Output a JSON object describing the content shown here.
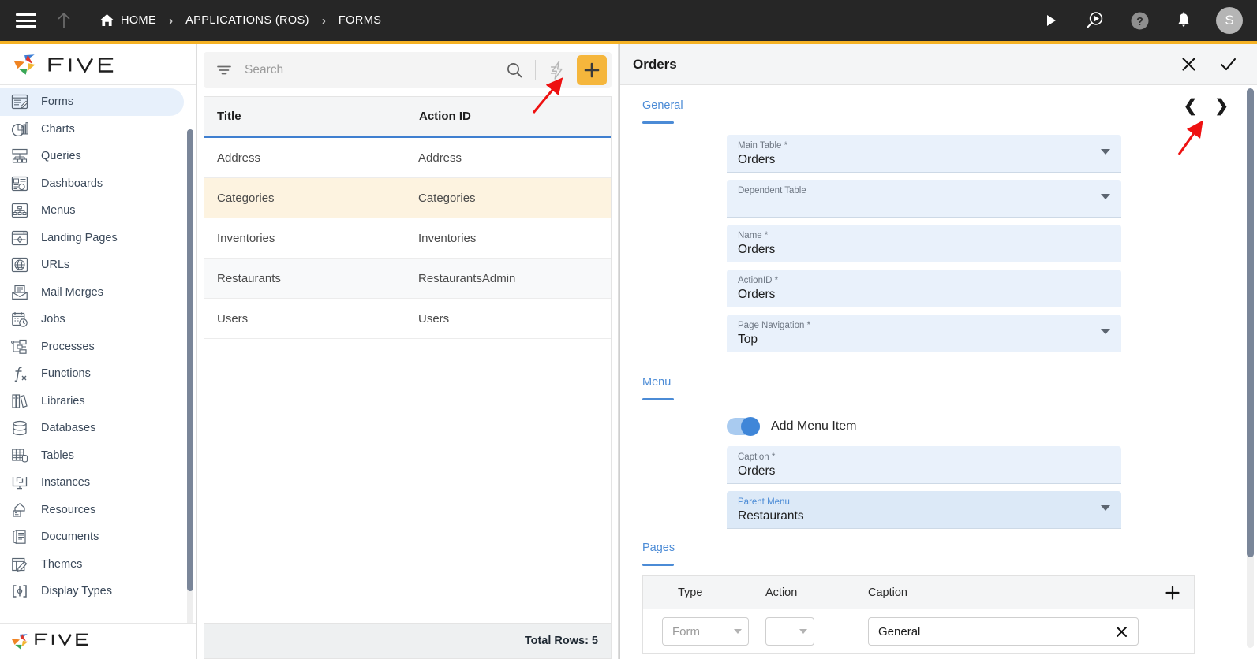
{
  "topbar": {
    "menu_icon": "hamburger-icon",
    "up_icon": "arrow-up-icon",
    "breadcrumbs": [
      {
        "label": "HOME",
        "icon": "home-icon"
      },
      {
        "label": "APPLICATIONS (ROS)",
        "icon": ""
      },
      {
        "label": "FORMS",
        "icon": ""
      }
    ],
    "separator": "›",
    "actions": [
      {
        "name": "run-icon",
        "title": "Run"
      },
      {
        "name": "debug-run-icon",
        "title": "Debug"
      },
      {
        "name": "help-icon",
        "title": "Help"
      },
      {
        "name": "notifications-bell-icon",
        "title": "Notifications"
      }
    ],
    "avatar_initial": "S"
  },
  "sidebar": {
    "brand_text": "FIVE",
    "items": [
      {
        "label": "Forms",
        "icon": "forms-icon",
        "active": true
      },
      {
        "label": "Charts",
        "icon": "charts-icon",
        "active": false
      },
      {
        "label": "Queries",
        "icon": "queries-icon",
        "active": false
      },
      {
        "label": "Dashboards",
        "icon": "dashboards-icon",
        "active": false
      },
      {
        "label": "Menus",
        "icon": "menus-icon",
        "active": false
      },
      {
        "label": "Landing Pages",
        "icon": "landing-pages-icon",
        "active": false
      },
      {
        "label": "URLs",
        "icon": "urls-icon",
        "active": false
      },
      {
        "label": "Mail Merges",
        "icon": "mail-merges-icon",
        "active": false
      },
      {
        "label": "Jobs",
        "icon": "jobs-icon",
        "active": false
      },
      {
        "label": "Processes",
        "icon": "processes-icon",
        "active": false
      },
      {
        "label": "Functions",
        "icon": "functions-icon",
        "active": false
      },
      {
        "label": "Libraries",
        "icon": "libraries-icon",
        "active": false
      },
      {
        "label": "Databases",
        "icon": "databases-icon",
        "active": false
      },
      {
        "label": "Tables",
        "icon": "tables-icon",
        "active": false
      },
      {
        "label": "Instances",
        "icon": "instances-icon",
        "active": false
      },
      {
        "label": "Resources",
        "icon": "resources-icon",
        "active": false
      },
      {
        "label": "Documents",
        "icon": "documents-icon",
        "active": false
      },
      {
        "label": "Themes",
        "icon": "themes-icon",
        "active": false
      },
      {
        "label": "Display Types",
        "icon": "display-types-icon",
        "active": false
      }
    ]
  },
  "list_panel": {
    "search": {
      "placeholder": "Search",
      "value": ""
    },
    "filter_icon": "filter-icon",
    "search_icon": "search-icon",
    "bolt_icon": "lightning-bolt-icon",
    "add_label": "+",
    "columns": [
      "Title",
      "Action ID"
    ],
    "rows": [
      {
        "title": "Address",
        "action_id": "Address"
      },
      {
        "title": "Categories",
        "action_id": "Categories"
      },
      {
        "title": "Inventories",
        "action_id": "Inventories"
      },
      {
        "title": "Restaurants",
        "action_id": "RestaurantsAdmin"
      },
      {
        "title": "Users",
        "action_id": "Users"
      }
    ],
    "selected_row_index": 1,
    "footer": "Total Rows: 5"
  },
  "detail": {
    "title": "Orders",
    "close_icon": "close-icon",
    "confirm_icon": "check-icon",
    "prev_icon": "chevron-left-icon",
    "next_icon": "chevron-right-icon",
    "sections": {
      "general": {
        "label": "General",
        "fields": [
          {
            "label": "Main Table",
            "required": true,
            "value": "Orders",
            "type": "select",
            "focused": false
          },
          {
            "label": "Dependent Table",
            "required": false,
            "value": "",
            "type": "select",
            "focused": false
          },
          {
            "label": "Name",
            "required": true,
            "value": "Orders",
            "type": "text",
            "focused": false
          },
          {
            "label": "ActionID",
            "required": true,
            "value": "Orders",
            "type": "text",
            "focused": false
          },
          {
            "label": "Page Navigation",
            "required": true,
            "value": "Top",
            "type": "select",
            "focused": false
          }
        ]
      },
      "menu": {
        "label": "Menu",
        "toggle": {
          "label": "Add Menu Item",
          "on": true
        },
        "fields": [
          {
            "label": "Caption",
            "required": true,
            "value": "Orders",
            "type": "text",
            "focused": false
          },
          {
            "label": "Parent Menu",
            "required": false,
            "value": "Restaurants",
            "type": "select",
            "focused": true
          }
        ]
      },
      "pages": {
        "label": "Pages",
        "columns": [
          "Type",
          "Action",
          "Caption"
        ],
        "add_icon": "plus-icon",
        "rows": [
          {
            "type": "Form",
            "action": "",
            "caption": "General",
            "clear_icon": "clear-icon"
          }
        ]
      }
    }
  },
  "colors": {
    "topbar_bg": "#262626",
    "accent_yellow": "#f5b225",
    "accent_blue": "#3f7fd0",
    "selected_row": "#fdf3e0",
    "field_bg": "#e9f1fb",
    "annotation_red": "#ee1111"
  },
  "annotations": [
    {
      "name": "arrow-to-bolt",
      "target": "lightning-bolt-icon"
    },
    {
      "name": "arrow-to-next",
      "target": "chevron-right-icon"
    }
  ]
}
